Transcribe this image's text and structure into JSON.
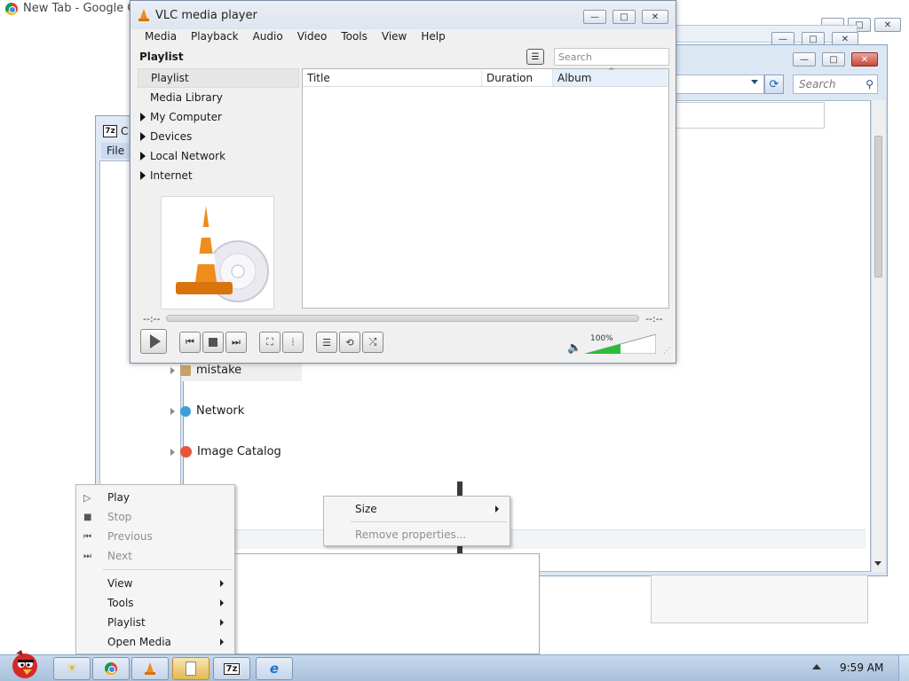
{
  "chrome": {
    "title": "New Tab - Google Ch"
  },
  "explorer": {
    "search_placeholder": "Search"
  },
  "app_7z": {
    "icon_text": "7z",
    "title_frag": "C",
    "menu_file": "File"
  },
  "tree": {
    "items": [
      "mistake",
      "Network",
      "Image Catalog"
    ]
  },
  "vlc": {
    "title": "VLC media player",
    "menu": [
      "Media",
      "Playback",
      "Audio",
      "Video",
      "Tools",
      "View",
      "Help"
    ],
    "playlist_header": "Playlist",
    "search_placeholder": "Search",
    "sidebar": [
      "Playlist",
      "Media Library",
      "My Computer",
      "Devices",
      "Local Network",
      "Internet"
    ],
    "columns": [
      "Title",
      "Duration",
      "Album"
    ],
    "time_elapsed": "--:--",
    "time_total": "--:--",
    "volume": "100%"
  },
  "context_menu_vlc": {
    "items": [
      "Play",
      "Stop",
      "Previous",
      "Next",
      "View",
      "Tools",
      "Playlist",
      "Open Media"
    ]
  },
  "context_menu_props": {
    "items": [
      "Size",
      "Remove properties..."
    ]
  },
  "taskbar": {
    "clock": "9:59 AM",
    "app_7z_label": "7z"
  },
  "colors": {
    "accent": "#3c8be0",
    "volume_green": "#2bbd3a",
    "vlc_orange": "#f08c1c"
  }
}
